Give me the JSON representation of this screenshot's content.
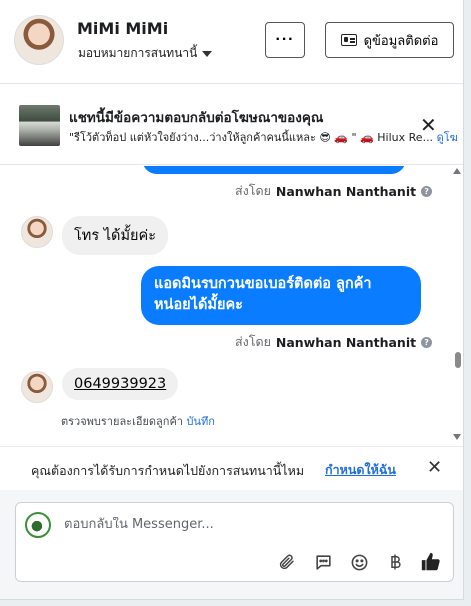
{
  "header": {
    "name": "MiMi MiMi",
    "assign_label": "มอบหมายการสนทนานี้",
    "more_label": "···",
    "contact_label": "ดูข้อมูลติดต่อ"
  },
  "ad_banner": {
    "title": "แชทนี้มีข้อความตอบกลับต่อโฆษณาของคุณ",
    "quote": "\"รีโว้ตัวท็อป แต่หัวใจยังว่าง...ว่างให้ลูกค้าคนนี้แหละ 😎 🚗 \" 🚗 Hilux Re...",
    "link": "ดูโฆ",
    "close": "✕"
  },
  "messages": {
    "sent_prefix": "ส่งโดย",
    "agent_name": "Nanwhan Nanthanit",
    "help": "?",
    "customer_1": "โทร ได้มั้ยค่ะ",
    "outgoing_1": "แอดมินรบกวนขอเบอร์ติดต่อ ลูกค้าหน่อยได้มั้ยคะ",
    "customer_phone": "0649939923",
    "note_text": "ตรวจพบรายละเอียดลูกค้า",
    "note_save": "บันทึก"
  },
  "reminder": {
    "text": "คุณต้องการได้รับการกำหนดไปยังการสนทนานี้ไหม",
    "link": "กำหนดให้ฉัน",
    "close": "✕"
  },
  "composer": {
    "placeholder": "ตอบกลับใน Messenger..."
  }
}
